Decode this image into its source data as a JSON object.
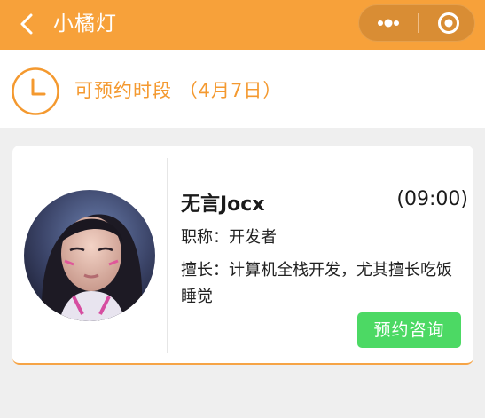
{
  "nav": {
    "title": "小橘灯",
    "back_icon": "chevron-left-icon",
    "more_icon": "more-dots-icon",
    "close_icon": "target-circle-icon"
  },
  "header": {
    "title": "可预约时段",
    "date": "（4月7日）",
    "icon": "clock-icon",
    "accent_color": "#f4992f"
  },
  "card": {
    "name": "无言Jocx",
    "time": "(09:00)",
    "title_label": "职称：",
    "title_value": "开发者",
    "skill_label": "擅长：",
    "skill_value": "计算机全栈开发，尤其擅长吃饭睡觉",
    "button_label": "预约咨询",
    "button_color": "#4cd964"
  }
}
